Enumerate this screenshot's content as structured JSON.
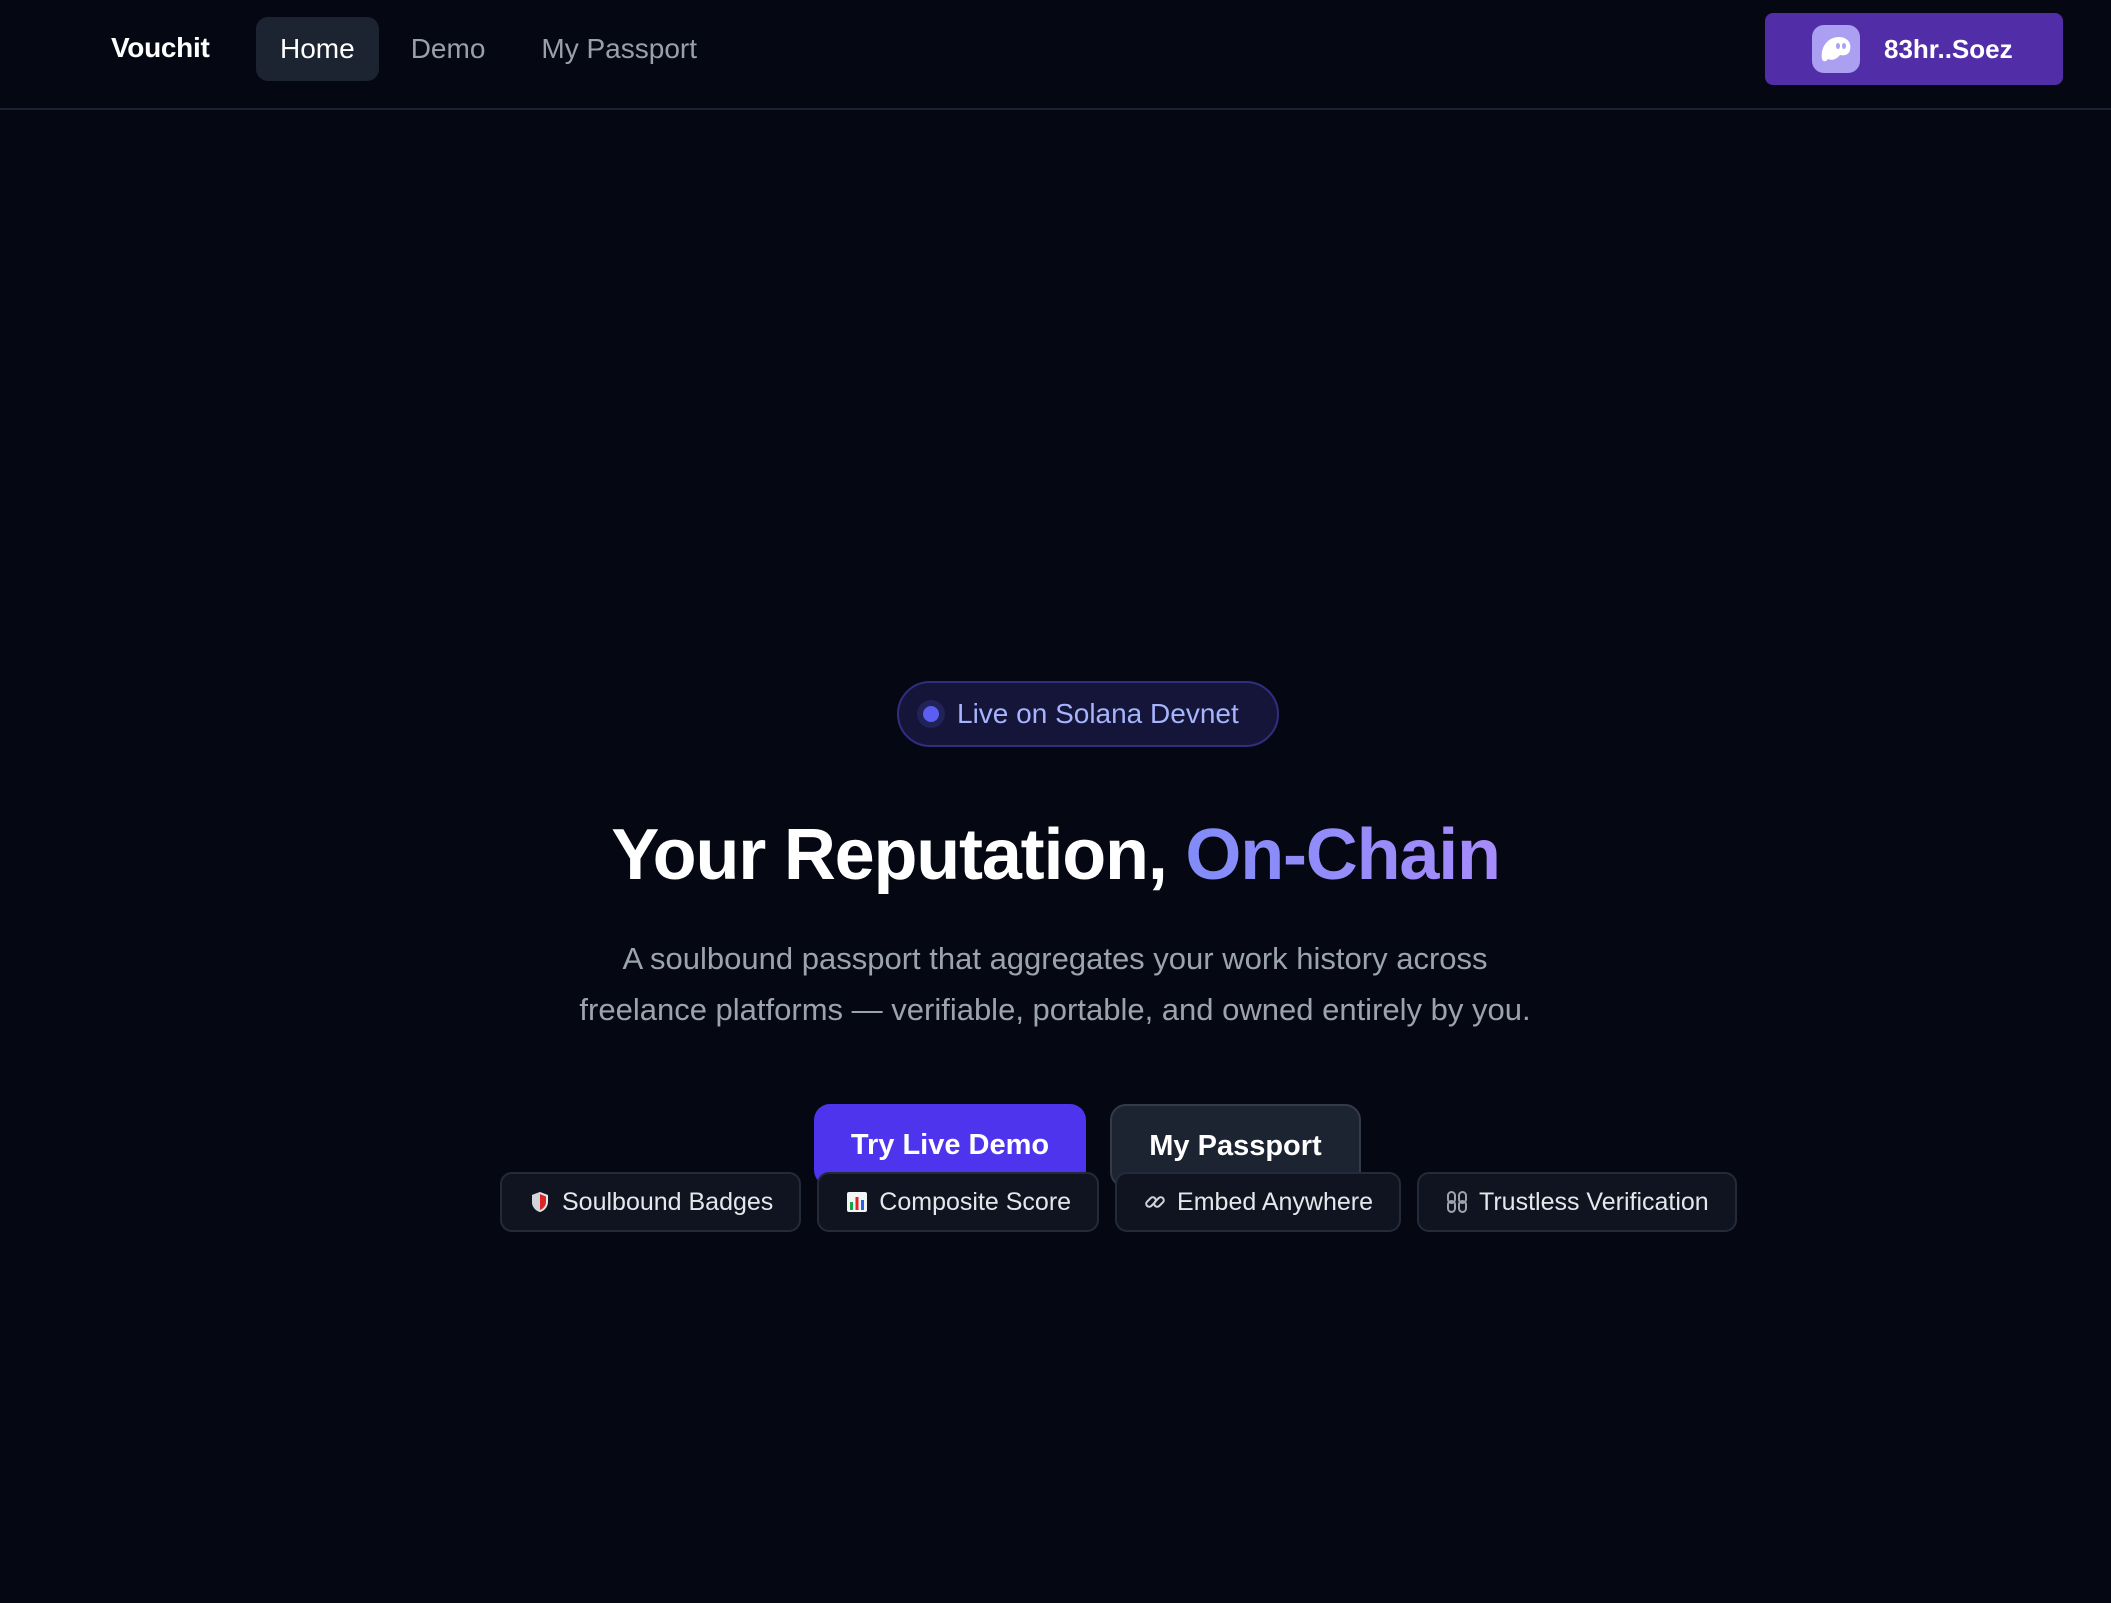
{
  "nav": {
    "brand": "Vouchit",
    "links": [
      {
        "label": "Home",
        "active": true
      },
      {
        "label": "Demo",
        "active": false
      },
      {
        "label": "My Passport",
        "active": false
      }
    ],
    "wallet": {
      "label": "83hr..Soez",
      "icon": "phantom-ghost-icon",
      "color": "#512da8"
    }
  },
  "hero": {
    "status_pill": "Live on Solana Devnet",
    "headline_main": "Your Reputation, ",
    "headline_accent": "On-Chain",
    "subtitle_line1": "A soulbound passport that aggregates your work history across",
    "subtitle_line2": "freelance platforms — verifiable, portable, and owned entirely by you.",
    "primary_cta": "Try Live Demo",
    "secondary_cta": "My Passport"
  },
  "features": [
    {
      "icon": "shield-icon",
      "label": "Soulbound Badges"
    },
    {
      "icon": "bar-chart-icon",
      "label": "Composite Score"
    },
    {
      "icon": "link-icon",
      "label": "Embed Anywhere"
    },
    {
      "icon": "chain-link-icon",
      "label": "Trustless Verification"
    }
  ],
  "colors": {
    "background": "#050813",
    "accent": "#818cf8",
    "primary_button": "#4f34ee",
    "wallet_button": "#512da8"
  }
}
